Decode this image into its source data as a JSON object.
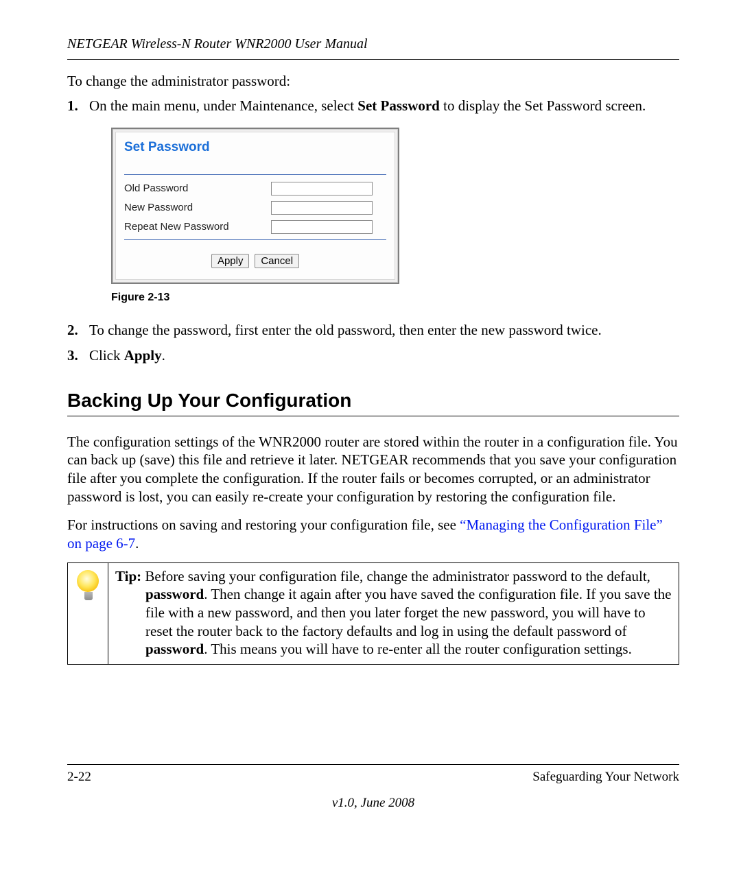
{
  "header": {
    "running_title": "NETGEAR Wireless-N Router WNR2000 User Manual"
  },
  "intro": "To change the administrator password:",
  "steps": {
    "s1": {
      "num": "1.",
      "text_a": "On the main menu, under Maintenance, select ",
      "bold": "Set Password",
      "text_b": " to display the Set Password screen."
    },
    "s2": {
      "num": "2.",
      "text": "To change the password, first enter the old password, then enter the new password twice."
    },
    "s3": {
      "num": "3.",
      "text_a": "Click ",
      "bold": "Apply",
      "text_b": "."
    }
  },
  "screenshot": {
    "title": "Set Password",
    "rows": {
      "old": {
        "label": "Old Password",
        "value": ""
      },
      "new": {
        "label": "New Password",
        "value": ""
      },
      "repeat": {
        "label": "Repeat New Password",
        "value": ""
      }
    },
    "buttons": {
      "apply": "Apply",
      "cancel": "Cancel"
    }
  },
  "figure_caption": "Figure 2-13",
  "section_heading": "Backing Up Your Configuration",
  "body": {
    "p1": "The configuration settings of the WNR2000 router are stored within the router in a configuration file. You can back up (save) this file and retrieve it later. NETGEAR recommends that you save your configuration file after you complete the configuration. If the router fails or becomes corrupted, or an administrator password is lost, you can easily re-create your configuration by restoring the configuration file.",
    "p2_a": "For instructions on saving and restoring your configuration file, see ",
    "p2_link": "“Managing the Configuration File” on page 6-7",
    "p2_b": "."
  },
  "tip": {
    "label": "Tip:",
    "t1": " Before saving your configuration file, change the administrator password to the default, ",
    "b1": "password",
    "t2": ". Then change it again after you have saved the configuration file. If you save the file with a new password, and then you later forget the new password, you will have to reset the router back to the factory defaults and log in using the default password of ",
    "b2": "password",
    "t3": ". This means you will have to re-enter all the router configuration settings."
  },
  "footer": {
    "page_num": "2-22",
    "chapter": "Safeguarding Your Network",
    "version": "v1.0, June 2008"
  }
}
